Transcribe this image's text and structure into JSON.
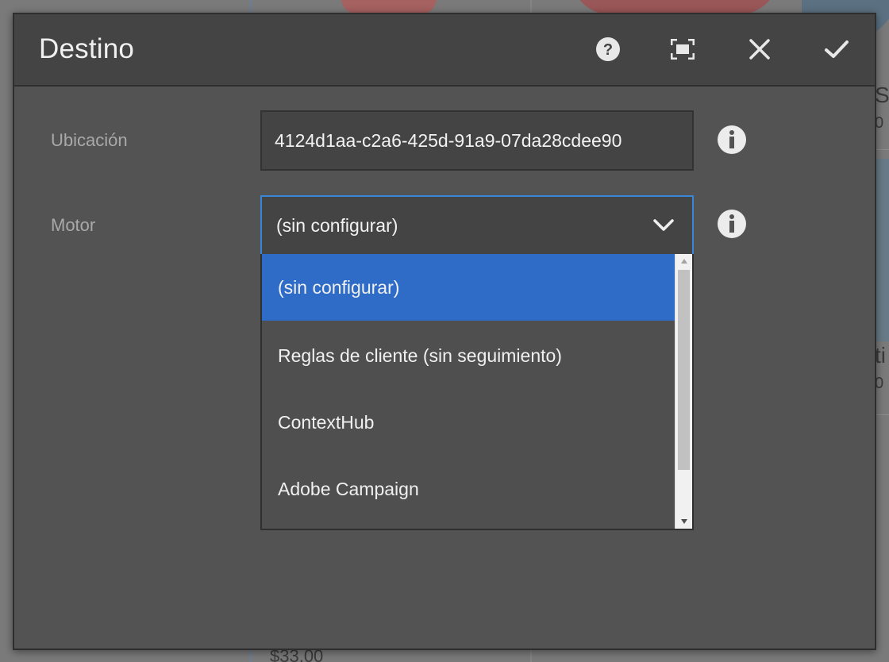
{
  "dialog": {
    "title": "Destino",
    "help_icon": "help-circle-icon",
    "fullscreen_icon": "fullscreen-icon",
    "close_icon": "close-icon",
    "done_icon": "checkmark-icon"
  },
  "fields": {
    "location": {
      "label": "Ubicación",
      "value": "4124d1aa-c2a6-425d-91a9-07da28cdee90",
      "info_icon": "info-icon"
    },
    "engine": {
      "label": "Motor",
      "selected": "(sin configurar)",
      "info_icon": "info-icon",
      "options": [
        "(sin configurar)",
        "Reglas de cliente (sin seguimiento)",
        "ContextHub",
        "Adobe Campaign"
      ]
    }
  },
  "background": {
    "price": "$33.00"
  },
  "colors": {
    "accent": "#2f6cc8",
    "focus_border": "#3a86d6",
    "dialog_bg": "#535353",
    "header_bg": "#444444"
  }
}
